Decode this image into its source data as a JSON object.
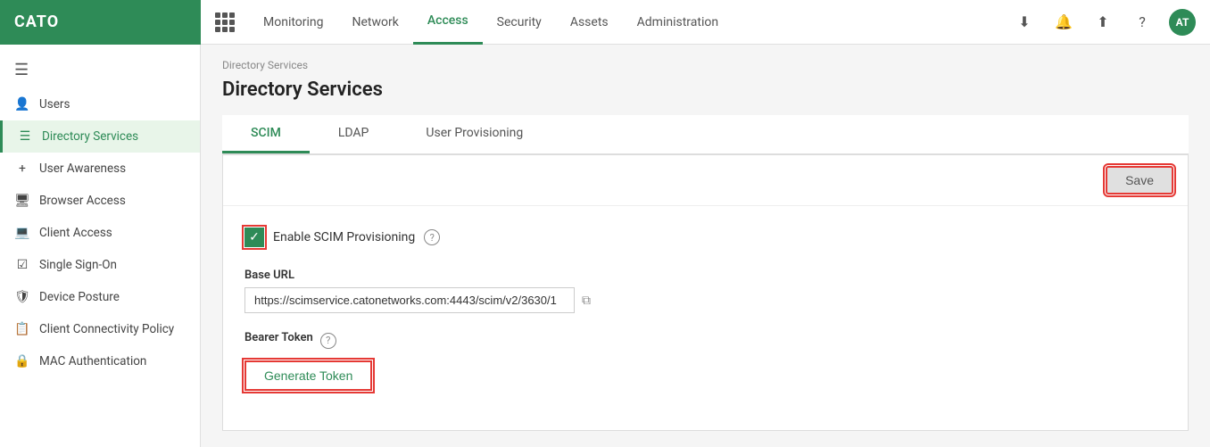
{
  "logo": "CATO",
  "nav": {
    "items": [
      {
        "id": "monitoring",
        "label": "Monitoring",
        "active": false
      },
      {
        "id": "network",
        "label": "Network",
        "active": false
      },
      {
        "id": "access",
        "label": "Access",
        "active": true
      },
      {
        "id": "security",
        "label": "Security",
        "active": false
      },
      {
        "id": "assets",
        "label": "Assets",
        "active": false
      },
      {
        "id": "administration",
        "label": "Administration",
        "active": false
      }
    ],
    "user_initials": "AT"
  },
  "sidebar": {
    "items": [
      {
        "id": "users",
        "label": "Users",
        "icon": "👤",
        "active": false
      },
      {
        "id": "directory-services",
        "label": "Directory Services",
        "icon": "☰",
        "active": true
      },
      {
        "id": "user-awareness",
        "label": "User Awareness",
        "icon": "+",
        "active": false
      },
      {
        "id": "browser-access",
        "label": "Browser Access",
        "icon": "⬜",
        "active": false
      },
      {
        "id": "client-access",
        "label": "Client Access",
        "icon": "⬜",
        "active": false
      },
      {
        "id": "single-sign-on",
        "label": "Single Sign-On",
        "icon": "☑",
        "active": false
      },
      {
        "id": "device-posture",
        "label": "Device Posture",
        "icon": "⬜",
        "active": false
      },
      {
        "id": "client-connectivity-policy",
        "label": "Client Connectivity Policy",
        "icon": "⬜",
        "active": false
      },
      {
        "id": "mac-authentication",
        "label": "MAC Authentication",
        "icon": "⬜",
        "active": false
      }
    ]
  },
  "breadcrumb": "Directory Services",
  "page_title": "Directory Services",
  "tabs": [
    {
      "id": "scim",
      "label": "SCIM",
      "active": true
    },
    {
      "id": "ldap",
      "label": "LDAP",
      "active": false
    },
    {
      "id": "user-provisioning",
      "label": "User Provisioning",
      "active": false
    }
  ],
  "panel": {
    "save_button": "Save",
    "enable_scim_label": "Enable SCIM Provisioning",
    "base_url_label": "Base URL",
    "base_url_value": "https://scimservice.catonetworks.com:4443/scim/v2/3630/1",
    "bearer_token_label": "Bearer Token",
    "generate_token_button": "Generate Token"
  }
}
